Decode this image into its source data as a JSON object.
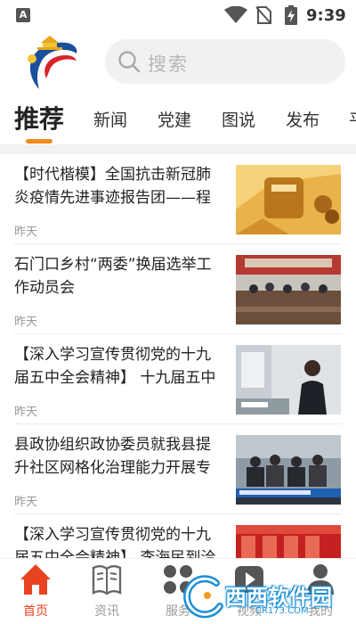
{
  "status_bar": {
    "notification_letter": "A",
    "time": "9:39",
    "icons": [
      "wifi-icon",
      "no-sim-icon",
      "battery-charging-icon"
    ]
  },
  "header": {
    "logo": "app-logo",
    "search": {
      "placeholder": "搜索"
    }
  },
  "tabs": [
    {
      "label": "推荐",
      "active": true
    },
    {
      "label": "新闻"
    },
    {
      "label": "党建"
    },
    {
      "label": "图说"
    },
    {
      "label": "发布"
    },
    {
      "label": "平"
    }
  ],
  "news": [
    {
      "title": "【时代楷模】全国抗击新冠肺炎疫情先进事迹报告团——程",
      "time": "昨天"
    },
    {
      "title": "石门口乡村“两委”换届选举工作动员会",
      "time": "昨天"
    },
    {
      "title": "【深入学习宣传贯彻党的十九届五中全会精神】 十九届五中",
      "time": "昨天"
    },
    {
      "title": "县政协组织政协委员就我县提升社区网格化治理能力开展专",
      "time": "昨天"
    },
    {
      "title": "【深入学习宣传贯彻党的十九届五中全会精神】 李海民到洽",
      "time": ""
    }
  ],
  "bottom_nav": [
    {
      "label": "首页",
      "icon": "home-icon",
      "active": true
    },
    {
      "label": "资讯",
      "icon": "book-icon"
    },
    {
      "label": "服务",
      "icon": "grid-icon"
    },
    {
      "label": "视频",
      "icon": "play-icon"
    },
    {
      "label": "我的",
      "icon": "user-icon"
    }
  ],
  "watermark": {
    "text": "西西软件园",
    "sub": "CR173.COM"
  },
  "colors": {
    "accent": "#f28b1d",
    "nav_active": "#e8421e",
    "nav_inactive": "#9a9a9a"
  }
}
